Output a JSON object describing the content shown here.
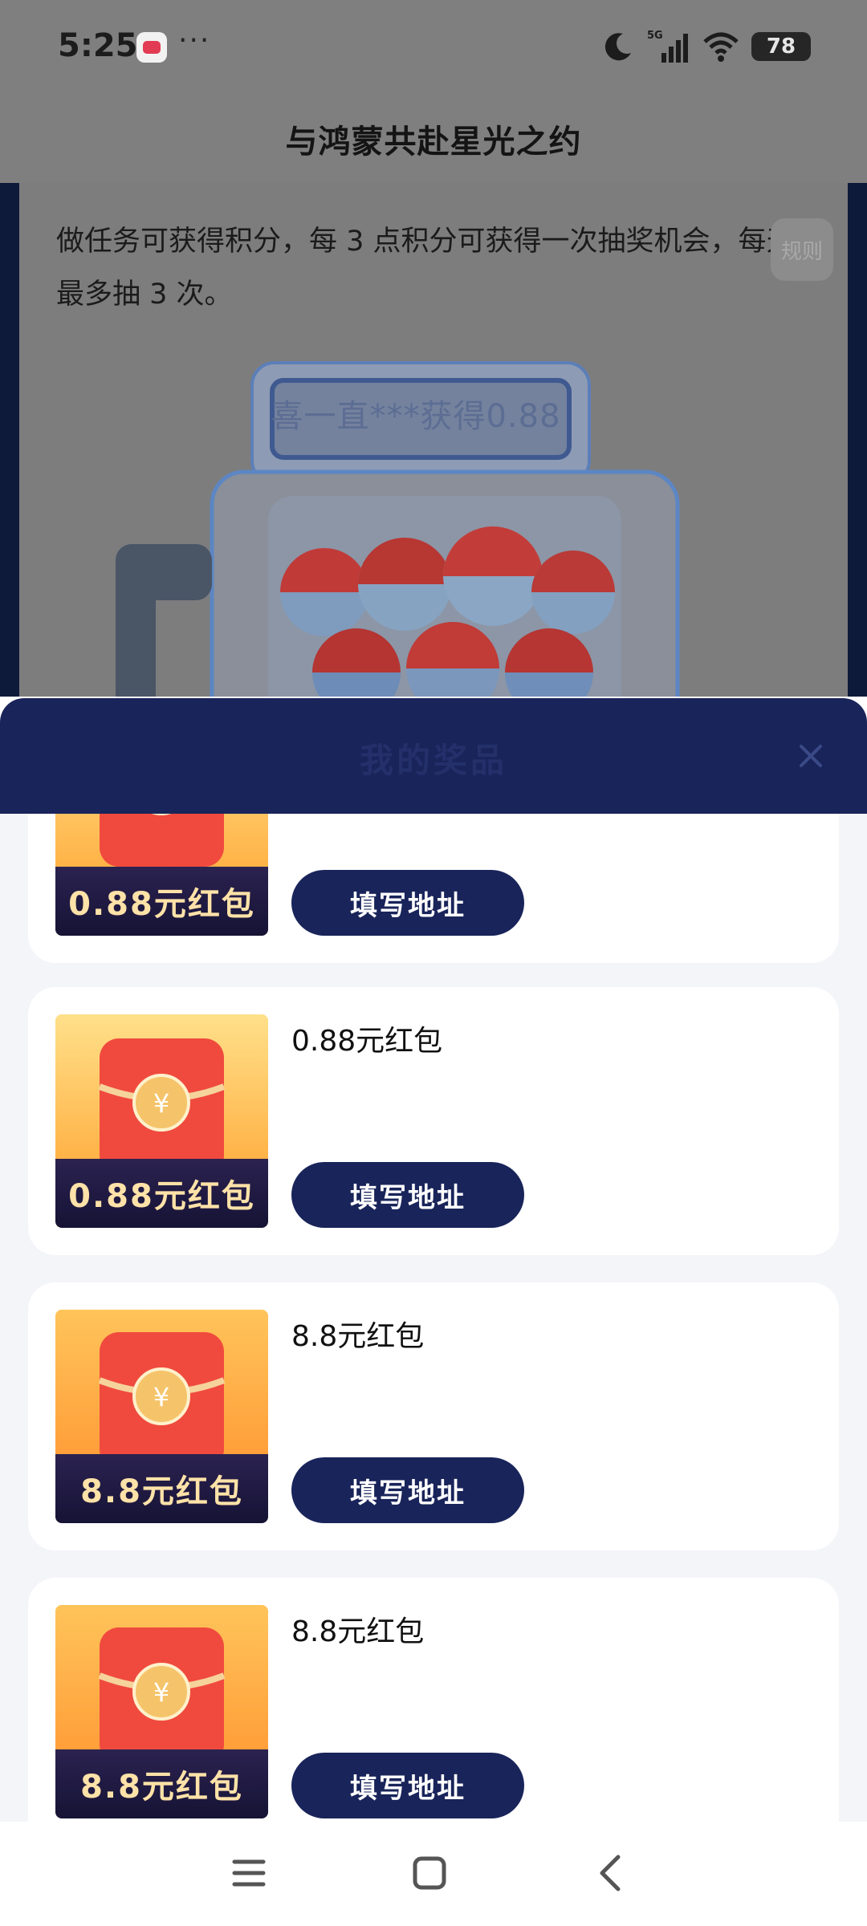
{
  "status_bar": {
    "time": "5:25",
    "dots": "···",
    "network": "5G",
    "battery": "78"
  },
  "header": {
    "title": "与鸿蒙共赴星光之约"
  },
  "intro": {
    "text": "做任务可获得积分，每 3 点积分可获得一次抽奖机会，每天最多抽 3 次。",
    "rules_button": "规则"
  },
  "machine": {
    "ticker": "喜一直***获得0.88"
  },
  "sheet": {
    "title": "我的奖品"
  },
  "prizes": [
    {
      "image_label": "0.88元红包",
      "name": "",
      "button": "填写地址"
    },
    {
      "image_label": "0.88元红包",
      "name": "0.88元红包",
      "button": "填写地址"
    },
    {
      "image_label": "8.8元红包",
      "name": "8.8元红包",
      "button": "填写地址"
    },
    {
      "image_label": "8.8元红包",
      "name": "8.8元红包",
      "button": "填写地址"
    }
  ],
  "colors": {
    "navy": "#19245a",
    "envelope_red": "#f04a3e",
    "gold": "#f5c46a"
  }
}
